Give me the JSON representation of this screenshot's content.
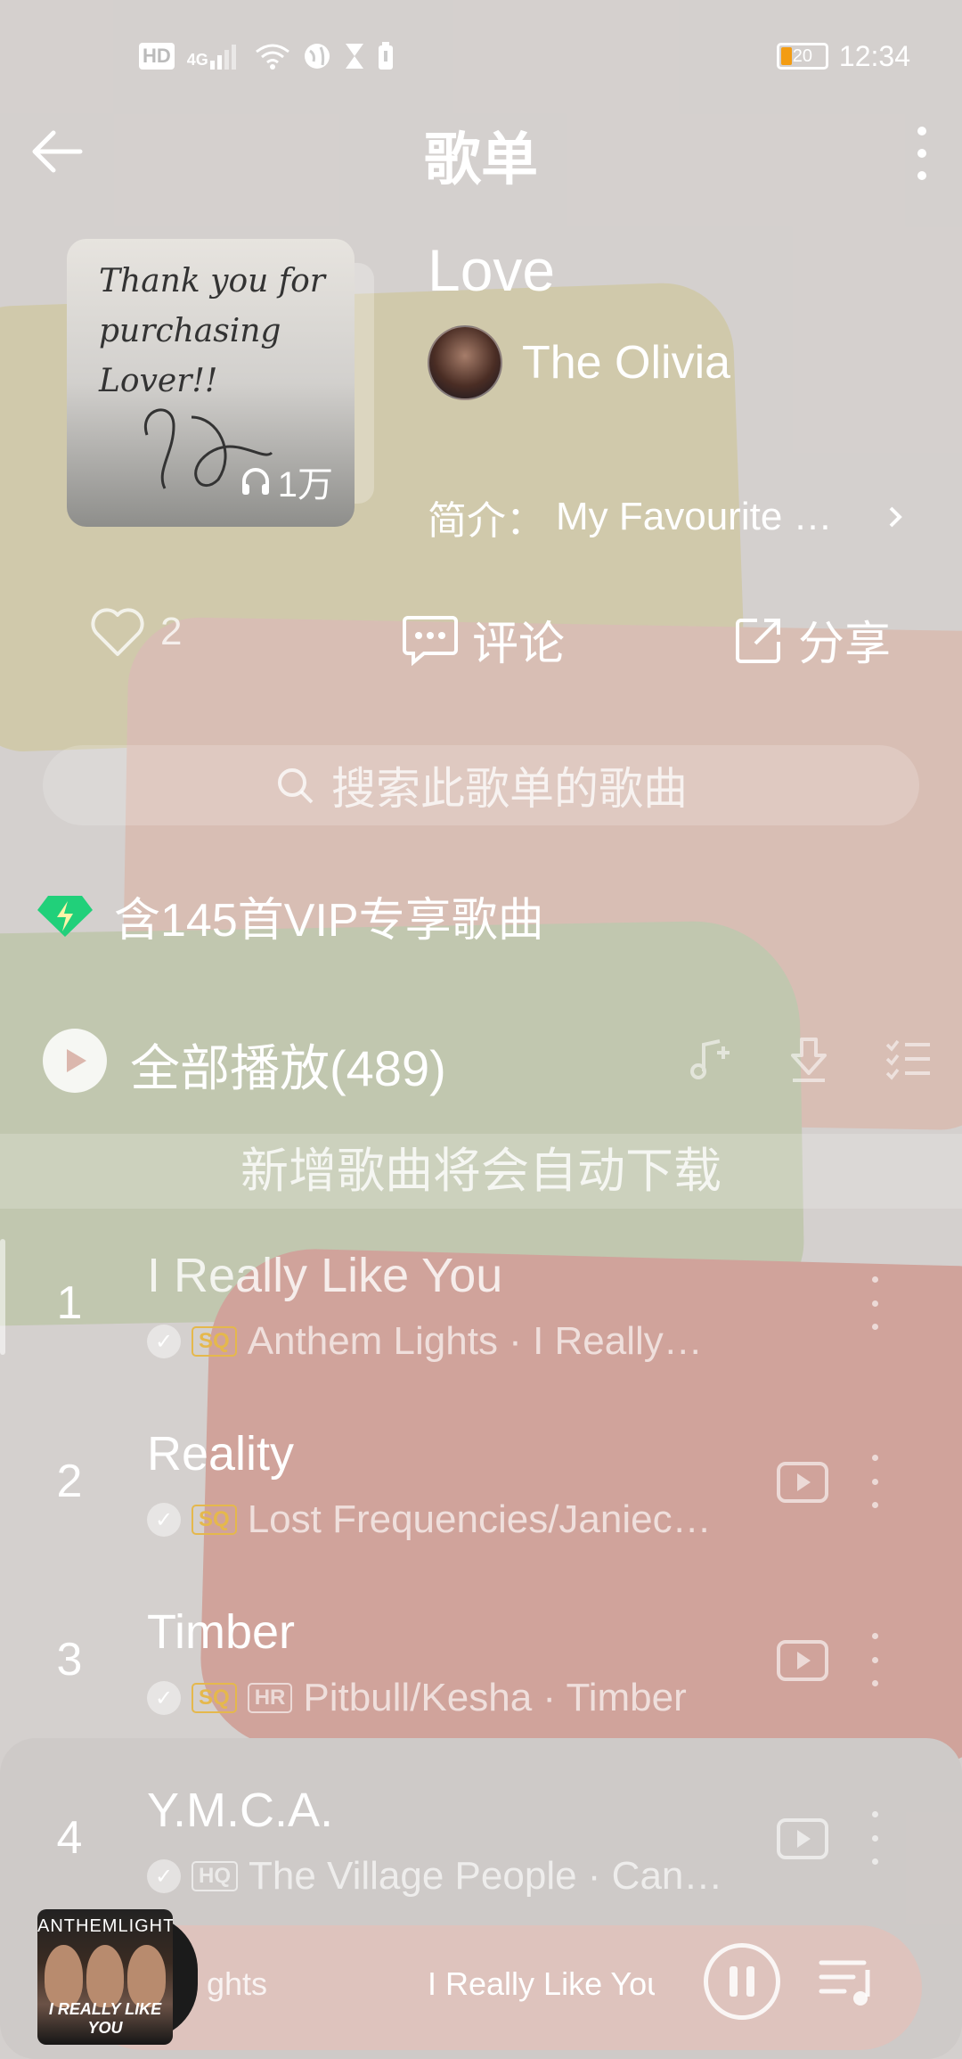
{
  "status_bar": {
    "chip": "HD",
    "network": "4G",
    "battery": "20",
    "time": "12:34"
  },
  "header": {
    "title": "歌单"
  },
  "playlist": {
    "name": "Love",
    "creator": "The Olivia",
    "plays": "1万",
    "intro_label": "简介：",
    "intro_text": "My Favourite …",
    "cover_line1": "Thank you for",
    "cover_line2": "purchasing Lover!!"
  },
  "actions": {
    "likes": "2",
    "comment_label": "评论",
    "share_label": "分享"
  },
  "search": {
    "placeholder": "搜索此歌单的歌曲"
  },
  "vip_note": "含145首VIP专享歌曲",
  "play_all": {
    "label": "全部播放(489)"
  },
  "auto_download_note": "新增歌曲将会自动下载",
  "songs": [
    {
      "index": "1",
      "title": "I Really Like You",
      "badges": [
        "SQ"
      ],
      "meta": "Anthem Lights · I Really…"
    },
    {
      "index": "2",
      "title": "Reality",
      "badges": [
        "SQ"
      ],
      "meta": "Lost Frequencies/Janiec…"
    },
    {
      "index": "3",
      "title": "Timber",
      "badges": [
        "SQ",
        "HR"
      ],
      "meta": "Pitbull/Kesha · Timber"
    },
    {
      "index": "4",
      "title": "Y.M.C.A.",
      "badges": [
        "HQ"
      ],
      "meta": "The Village People · Can…"
    }
  ],
  "player": {
    "artist_fragment": "ghts",
    "song": "I Really Like You",
    "art_top": "ANTHEMLIGHTS",
    "art_bottom": "I REALLY LIKE YOU"
  },
  "colors": {
    "vip_green": "#21d07a",
    "quality_gold": "#e5b84c",
    "battery_orange": "#f39c12"
  }
}
